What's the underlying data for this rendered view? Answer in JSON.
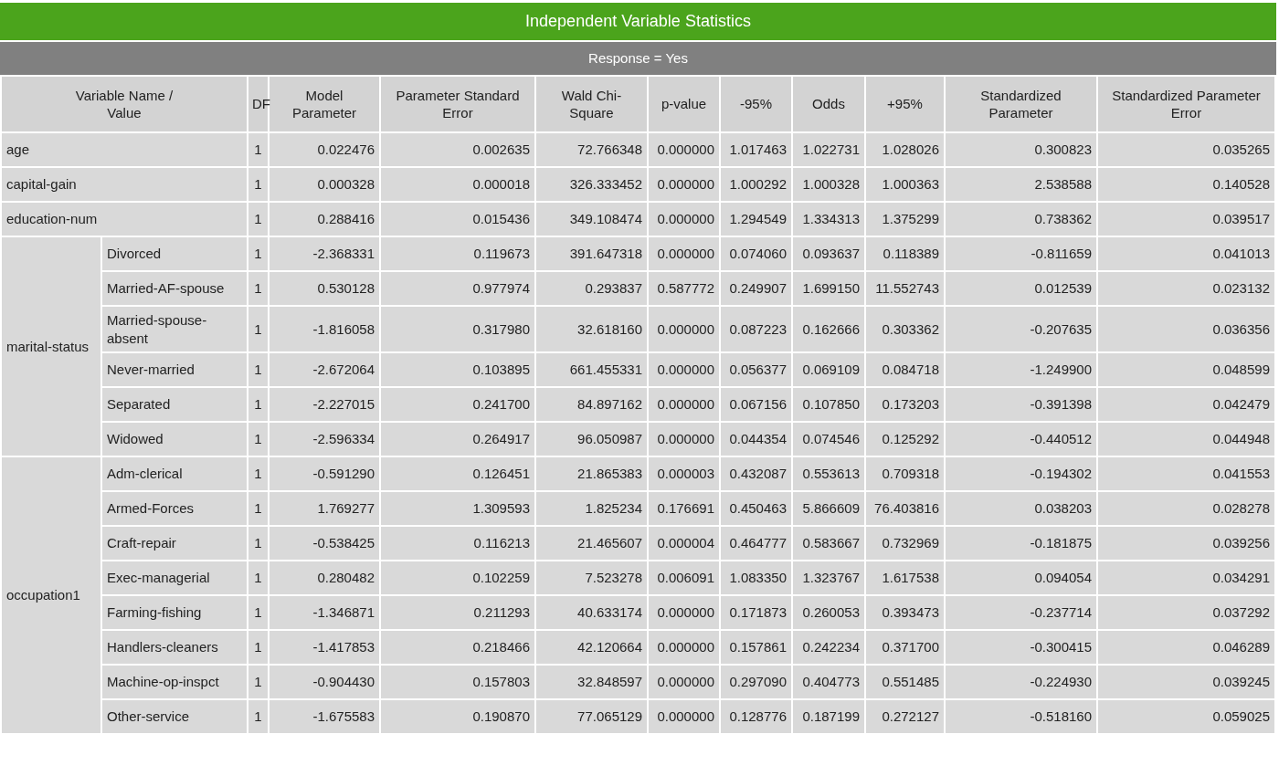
{
  "title": "Independent Variable Statistics",
  "response": "Response = Yes",
  "columns": [
    "Variable Name / Value",
    "DF",
    "Model Parameter",
    "Parameter Standard Error",
    "Wald Chi-Square",
    "p-value",
    "-95%",
    "Odds",
    "+95%",
    "Standardized Parameter",
    "Standardized Parameter Error"
  ],
  "rows": [
    {
      "name": "age",
      "values": [
        "1",
        "0.022476",
        "0.002635",
        "72.766348",
        "0.000000",
        "1.017463",
        "1.022731",
        "1.028026",
        "0.300823",
        "0.035265"
      ]
    },
    {
      "name": "capital-gain",
      "values": [
        "1",
        "0.000328",
        "0.000018",
        "326.333452",
        "0.000000",
        "1.000292",
        "1.000328",
        "1.000363",
        "2.538588",
        "0.140528"
      ]
    },
    {
      "name": "education-num",
      "values": [
        "1",
        "0.288416",
        "0.015436",
        "349.108474",
        "0.000000",
        "1.294549",
        "1.334313",
        "1.375299",
        "0.738362",
        "0.039517"
      ]
    },
    {
      "name": "marital-status",
      "children": [
        {
          "name": "Divorced",
          "values": [
            "1",
            "-2.368331",
            "0.119673",
            "391.647318",
            "0.000000",
            "0.074060",
            "0.093637",
            "0.118389",
            "-0.811659",
            "0.041013"
          ]
        },
        {
          "name": "Married-AF-spouse",
          "values": [
            "1",
            "0.530128",
            "0.977974",
            "0.293837",
            "0.587772",
            "0.249907",
            "1.699150",
            "11.552743",
            "0.012539",
            "0.023132"
          ]
        },
        {
          "name": "Married-spouse-absent",
          "values": [
            "1",
            "-1.816058",
            "0.317980",
            "32.618160",
            "0.000000",
            "0.087223",
            "0.162666",
            "0.303362",
            "-0.207635",
            "0.036356"
          ]
        },
        {
          "name": "Never-married",
          "values": [
            "1",
            "-2.672064",
            "0.103895",
            "661.455331",
            "0.000000",
            "0.056377",
            "0.069109",
            "0.084718",
            "-1.249900",
            "0.048599"
          ]
        },
        {
          "name": "Separated",
          "values": [
            "1",
            "-2.227015",
            "0.241700",
            "84.897162",
            "0.000000",
            "0.067156",
            "0.107850",
            "0.173203",
            "-0.391398",
            "0.042479"
          ]
        },
        {
          "name": "Widowed",
          "values": [
            "1",
            "-2.596334",
            "0.264917",
            "96.050987",
            "0.000000",
            "0.044354",
            "0.074546",
            "0.125292",
            "-0.440512",
            "0.044948"
          ]
        }
      ]
    },
    {
      "name": "occupation1",
      "children": [
        {
          "name": "Adm-clerical",
          "values": [
            "1",
            "-0.591290",
            "0.126451",
            "21.865383",
            "0.000003",
            "0.432087",
            "0.553613",
            "0.709318",
            "-0.194302",
            "0.041553"
          ]
        },
        {
          "name": "Armed-Forces",
          "values": [
            "1",
            "1.769277",
            "1.309593",
            "1.825234",
            "0.176691",
            "0.450463",
            "5.866609",
            "76.403816",
            "0.038203",
            "0.028278"
          ]
        },
        {
          "name": "Craft-repair",
          "values": [
            "1",
            "-0.538425",
            "0.116213",
            "21.465607",
            "0.000004",
            "0.464777",
            "0.583667",
            "0.732969",
            "-0.181875",
            "0.039256"
          ]
        },
        {
          "name": "Exec-managerial",
          "values": [
            "1",
            "0.280482",
            "0.102259",
            "7.523278",
            "0.006091",
            "1.083350",
            "1.323767",
            "1.617538",
            "0.094054",
            "0.034291"
          ]
        },
        {
          "name": "Farming-fishing",
          "values": [
            "1",
            "-1.346871",
            "0.211293",
            "40.633174",
            "0.000000",
            "0.171873",
            "0.260053",
            "0.393473",
            "-0.237714",
            "0.037292"
          ]
        },
        {
          "name": "Handlers-cleaners",
          "values": [
            "1",
            "-1.417853",
            "0.218466",
            "42.120664",
            "0.000000",
            "0.157861",
            "0.242234",
            "0.371700",
            "-0.300415",
            "0.046289"
          ]
        },
        {
          "name": "Machine-op-inspct",
          "values": [
            "1",
            "-0.904430",
            "0.157803",
            "32.848597",
            "0.000000",
            "0.297090",
            "0.404773",
            "0.551485",
            "-0.224930",
            "0.039245"
          ]
        },
        {
          "name": "Other-service",
          "values": [
            "1",
            "-1.675583",
            "0.190870",
            "77.065129",
            "0.000000",
            "0.128776",
            "0.187199",
            "0.272127",
            "-0.518160",
            "0.059025"
          ]
        }
      ]
    }
  ]
}
